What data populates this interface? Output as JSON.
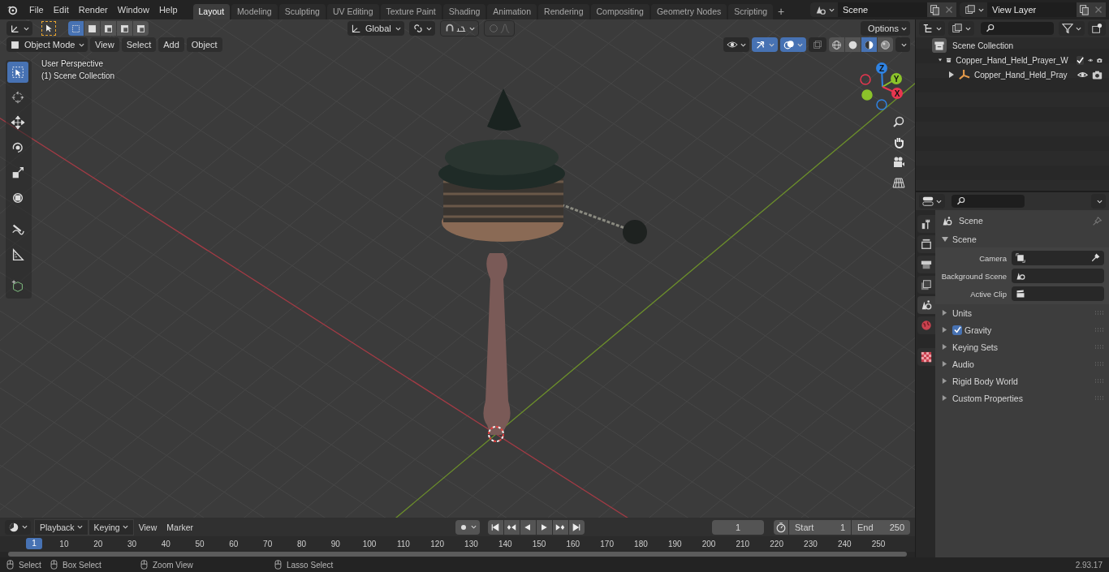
{
  "top_bar": {
    "menus": [
      "File",
      "Edit",
      "Render",
      "Window",
      "Help"
    ],
    "workspaces": [
      {
        "label": "Layout",
        "selected": true
      },
      {
        "label": "Modeling",
        "selected": false
      },
      {
        "label": "Sculpting",
        "selected": false
      },
      {
        "label": "UV Editing",
        "selected": false
      },
      {
        "label": "Texture Paint",
        "selected": false
      },
      {
        "label": "Shading",
        "selected": false
      },
      {
        "label": "Animation",
        "selected": false
      },
      {
        "label": "Rendering",
        "selected": false
      },
      {
        "label": "Compositing",
        "selected": false
      },
      {
        "label": "Geometry Nodes",
        "selected": false
      },
      {
        "label": "Scripting",
        "selected": false
      }
    ],
    "add_tab": "+",
    "scene": "Scene",
    "view_layer": "View Layer"
  },
  "viewport": {
    "tool_header": {
      "select_modes": [
        {
          "selected": true
        },
        {
          "selected": false
        },
        {
          "selected": false
        },
        {
          "selected": false
        },
        {
          "selected": false
        }
      ],
      "orientation": "Global",
      "snap": false,
      "proportional_editing": false,
      "options": "Options"
    },
    "header": {
      "mode": "Object Mode",
      "menus": [
        "View",
        "Select",
        "Add",
        "Object"
      ],
      "show_gizmos": true,
      "show_overlays": true,
      "xray": false,
      "shading": [
        {
          "selected": false
        },
        {
          "selected": false
        },
        {
          "selected": true
        },
        {
          "selected": false
        }
      ]
    },
    "overlay_text": [
      "User Perspective",
      "(1) Scene Collection"
    ],
    "tools": [
      {
        "kind": "select",
        "selected": true
      },
      {
        "kind": "cursor",
        "selected": false
      },
      {
        "kind": "move",
        "selected": false
      },
      {
        "kind": "rotate",
        "selected": false
      },
      {
        "kind": "scale",
        "selected": false
      },
      {
        "kind": "transform",
        "selected": false
      },
      {
        "kind": "annotate",
        "selected": false
      },
      {
        "kind": "measure",
        "selected": false
      },
      {
        "kind": "add_cube",
        "selected": false
      }
    ],
    "gizmo_axes": [
      {
        "label": "Z",
        "color": "#2f83e3"
      },
      {
        "label": "Y",
        "color": "#8bc32a"
      },
      {
        "label": "X",
        "color": "#e8364f"
      }
    ]
  },
  "outliner": {
    "items": [
      {
        "label": "Scene Collection",
        "kind": "root",
        "children": [
          {
            "label": "Copper_Hand_Held_Prayer_W",
            "kind": "collection",
            "expanded": true,
            "checked": true,
            "children": [
              {
                "label": "Copper_Hand_Held_Pray",
                "kind": "empty",
                "expanded": false
              }
            ]
          }
        ]
      }
    ]
  },
  "properties": {
    "tabs": [
      {
        "kind": "tool",
        "selected": false
      },
      {
        "kind": "render",
        "selected": false
      },
      {
        "kind": "output",
        "selected": false
      },
      {
        "kind": "view_layer",
        "selected": false
      },
      {
        "kind": "scene",
        "selected": true
      },
      {
        "kind": "world",
        "selected": false
      },
      {
        "kind": "texture",
        "selected": false
      }
    ],
    "context": "Scene",
    "panel": {
      "title": "Scene",
      "expanded": true,
      "fields": [
        {
          "label": "Camera",
          "kind": "camera"
        },
        {
          "label": "Background Scene",
          "kind": "scene"
        },
        {
          "label": "Active Clip",
          "kind": "clip"
        }
      ]
    },
    "subpanels": [
      {
        "label": "Units",
        "expanded": false
      },
      {
        "label": "Gravity",
        "expanded": false,
        "checkbox": {
          "checked": true
        }
      },
      {
        "label": "Keying Sets",
        "expanded": false
      },
      {
        "label": "Audio",
        "expanded": false
      },
      {
        "label": "Rigid Body World",
        "expanded": false
      },
      {
        "label": "Custom Properties",
        "expanded": false
      }
    ]
  },
  "timeline": {
    "menus": [
      {
        "label": "Playback",
        "dropdown": true
      },
      {
        "label": "Keying",
        "dropdown": true
      },
      {
        "label": "View",
        "dropdown": false
      },
      {
        "label": "Marker",
        "dropdown": false
      }
    ],
    "current_frame": "1",
    "start_label": "Start",
    "start": "1",
    "end_label": "End",
    "end": "250",
    "frame_marker": "1",
    "ruler": [
      "10",
      "20",
      "30",
      "40",
      "50",
      "60",
      "70",
      "80",
      "90",
      "100",
      "110",
      "120",
      "130",
      "140",
      "150",
      "160",
      "170",
      "180",
      "190",
      "200",
      "210",
      "220",
      "230",
      "240",
      "250"
    ]
  },
  "status_bar": {
    "hints": [
      "Select",
      "Box Select",
      "Zoom View",
      "Lasso Select"
    ],
    "version": "2.93.17"
  }
}
